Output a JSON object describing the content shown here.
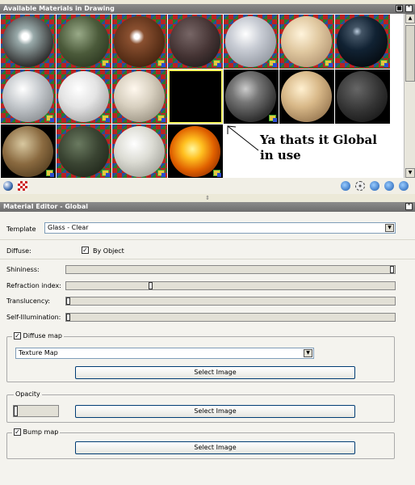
{
  "materials_panel": {
    "title": "Available Materials in Drawing"
  },
  "annotation": {
    "line1": "Ya thats it Global",
    "line2": "in use"
  },
  "editor_panel": {
    "title": "Material Editor - Global"
  },
  "template": {
    "label": "Template",
    "value": "Glass - Clear"
  },
  "diffuse": {
    "label": "Diffuse:",
    "by_object_label": "By Object",
    "by_object_checked": true
  },
  "sliders": [
    {
      "label": "Shininess:",
      "value": 1.0
    },
    {
      "label": "Refraction index:",
      "value": 0.25
    },
    {
      "label": "Translucency:",
      "value": 0.0
    },
    {
      "label": "Self-Illumination:",
      "value": 0.0
    }
  ],
  "diffuse_map": {
    "label": "Diffuse map",
    "checked": true,
    "type_value": "Texture Map",
    "button": "Select Image"
  },
  "opacity": {
    "label": "Opacity",
    "button": "Select Image",
    "value": 0.0
  },
  "bump_map": {
    "label": "Bump map",
    "checked": true,
    "button": "Select Image"
  },
  "icons": {
    "toolbar_left": [
      "sphere-preview-icon",
      "checker-background-icon"
    ],
    "toolbar_right": [
      "create-material-icon",
      "purge-materials-icon",
      "swap-icon",
      "export-icon",
      "details-icon"
    ]
  }
}
